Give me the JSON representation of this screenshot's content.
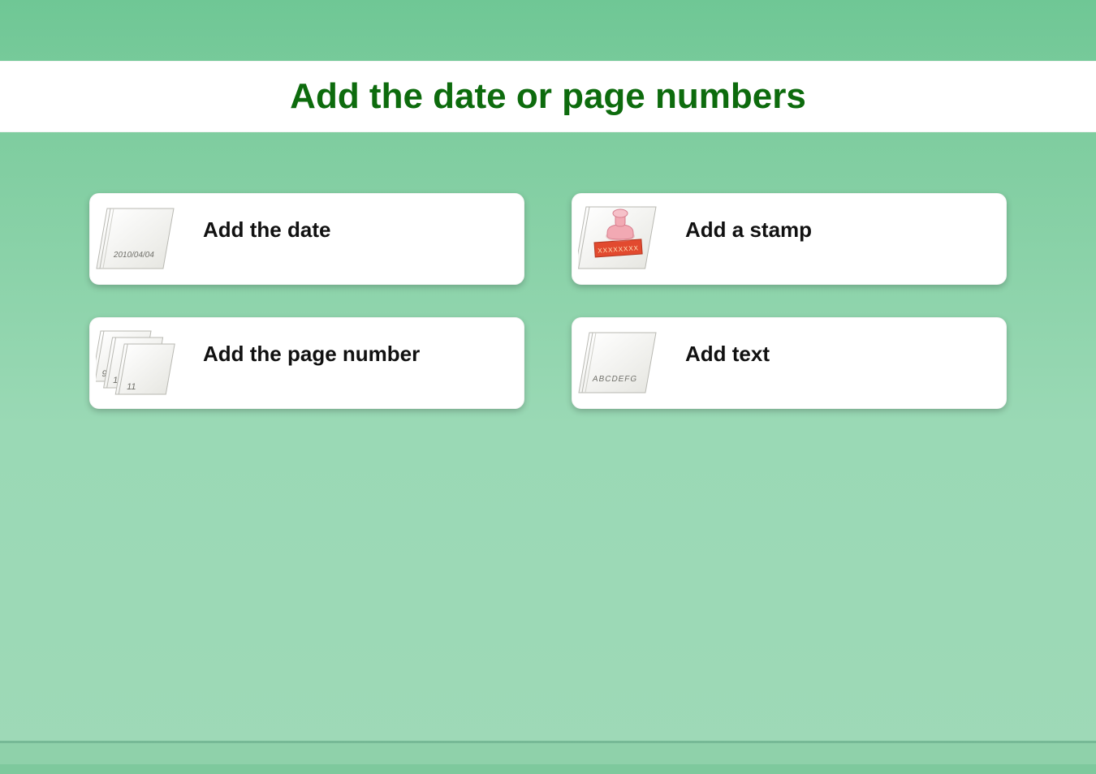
{
  "header": {
    "title": "Add the date or page numbers"
  },
  "cards": [
    {
      "label": "Add the date",
      "icon": "date",
      "iconText": "2010/04/04"
    },
    {
      "label": "Add a stamp",
      "icon": "stamp",
      "iconText": "XXXXXXXX"
    },
    {
      "label": "Add the page number",
      "icon": "pages",
      "iconText": "9 10 11"
    },
    {
      "label": "Add text",
      "icon": "text",
      "iconText": "ABCDEFG"
    }
  ],
  "colors": {
    "titleText": "#0d6b0d",
    "bgTop": "#6fc795",
    "bgBottom": "#9ed9b7",
    "cardBg": "#ffffff"
  }
}
